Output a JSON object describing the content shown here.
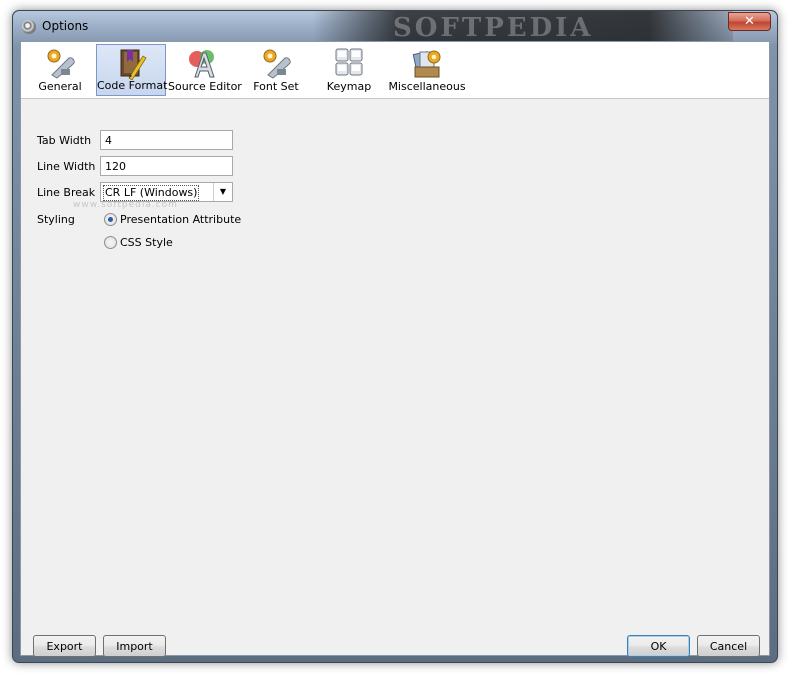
{
  "window": {
    "title": "Options",
    "watermark": "SOFTPEDIA",
    "close_glyph": "✕"
  },
  "toolbar": {
    "items": [
      {
        "label": "General",
        "icon": "wrench-gear-icon"
      },
      {
        "label": "Code Format",
        "icon": "pencil-book-icon"
      },
      {
        "label": "Source Editor",
        "icon": "font-a-icon"
      },
      {
        "label": "Font Set",
        "icon": "wrench-gear-icon"
      },
      {
        "label": "Keymap",
        "icon": "keyboard-keys-icon"
      },
      {
        "label": "Miscellaneous",
        "icon": "cards-gear-icon"
      }
    ],
    "active_index": 1
  },
  "form": {
    "tab_width_label": "Tab Width",
    "tab_width_value": "4",
    "line_width_label": "Line Width",
    "line_width_value": "120",
    "line_break_label": "Line Break",
    "line_break_value": "CR LF (Windows)",
    "styling_label": "Styling",
    "styling_options": [
      {
        "label": "Presentation Attribute",
        "selected": true
      },
      {
        "label": "CSS Style",
        "selected": false
      }
    ]
  },
  "footer": {
    "export_label": "Export",
    "import_label": "Import",
    "ok_label": "OK",
    "cancel_label": "Cancel"
  },
  "colors": {
    "active_tab_border": "#7d97c8",
    "close_button": "#c04531",
    "radio_dot": "#2a5caa"
  }
}
